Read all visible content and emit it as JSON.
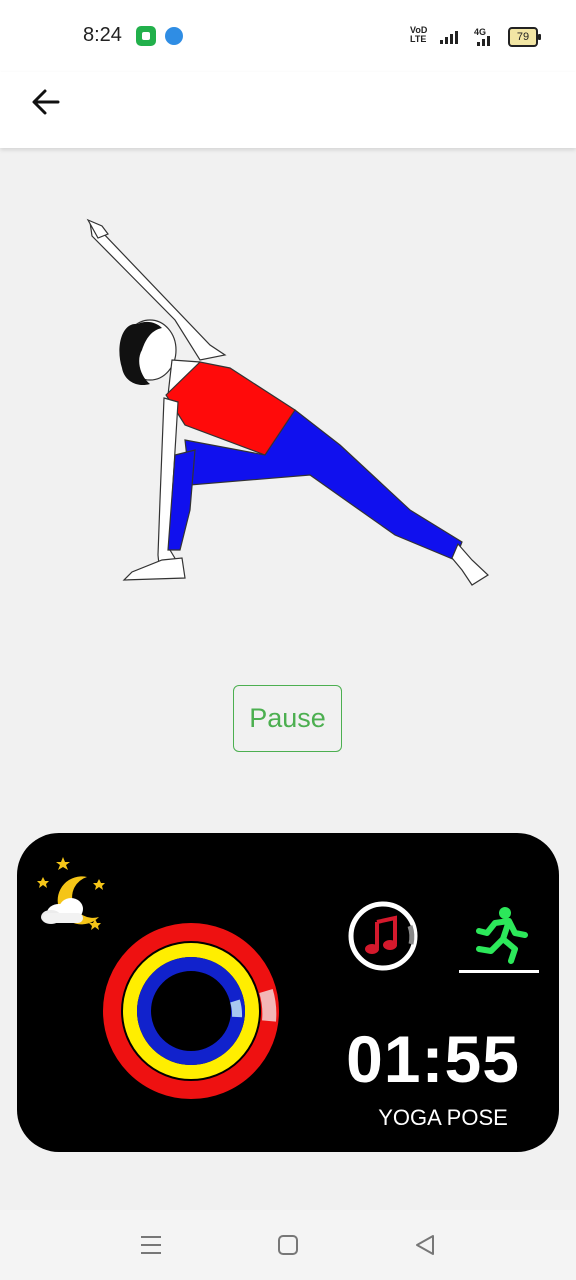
{
  "status_bar": {
    "time": "8:24",
    "volte_top": "VoD",
    "volte_bottom": "LTE",
    "network": "4G",
    "battery": "79",
    "icons": [
      "app-notification-icon",
      "app-notification-icon-2",
      "volte-icon",
      "signal-icon",
      "signal-4g-icon",
      "battery-icon"
    ]
  },
  "app_bar": {
    "back_icon": "arrow-left-icon"
  },
  "pose_image": {
    "subject": "extended-side-angle-yoga-pose"
  },
  "controls": {
    "pause_label": "Pause"
  },
  "panel": {
    "night_icon": "moon-stars-cloud-icon",
    "rings_icon": "activity-rings-icon",
    "music_icon": "music-note-icon",
    "run_icon": "running-person-icon",
    "timer": "01:55",
    "label": "YOGA POSE",
    "ring_colors": {
      "outer": "#ee1111",
      "middle": "#ffee00",
      "inner": "#1122cc"
    }
  },
  "nav_bar": {
    "icons": [
      "menu-icon",
      "home-square-icon",
      "back-triangle-icon"
    ]
  }
}
